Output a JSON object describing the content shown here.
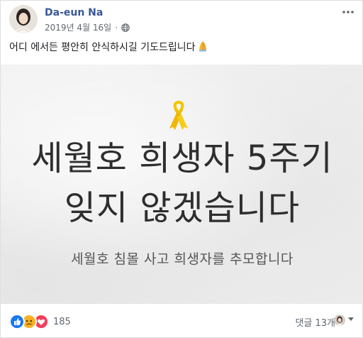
{
  "post": {
    "author": "Da-eun Na",
    "date": "2019년 4월 16일",
    "separator": "·",
    "privacy_icon": "globe-icon",
    "text": "어디 에서든 평안히 안식하시길 기도드립니다",
    "text_emoji": "folded-hands-icon"
  },
  "image": {
    "ribbon_icon": "yellow-ribbon-icon",
    "line1": "세월호 희생자 5주기",
    "line2": "잊지 않겠습니다",
    "subline": "세월호 침몰 사고 희생자를 추모합니다",
    "ribbon_color": "#f5c400"
  },
  "footer": {
    "reaction_icons": [
      "like-icon",
      "sad-icon",
      "love-icon"
    ],
    "reaction_count": "185",
    "comment_count": "댓글 13개"
  },
  "colors": {
    "author_link": "#385898",
    "meta_gray": "#616770",
    "like_blue": "#1877f2",
    "love_red": "#f33e58",
    "sad_yellow": "#f7b125"
  }
}
